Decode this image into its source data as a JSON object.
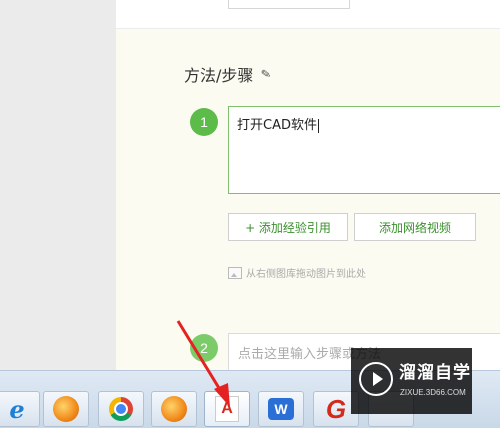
{
  "section": {
    "title": "方法/步骤",
    "edit_icon": "pencil-icon"
  },
  "step1": {
    "number": "1",
    "text": "打开CAD软件"
  },
  "buttons": {
    "add_ref": "+ 添加经验引用",
    "add_video": "添加网络视频"
  },
  "drag_hint": {
    "icon": "image-icon",
    "text": "从右侧图库拖动图片到此处"
  },
  "step2": {
    "number": "2",
    "placeholder": "点击这里输入步骤或方法"
  },
  "taskbar": {
    "items": [
      {
        "name": "ie-icon",
        "glyph": "e"
      },
      {
        "name": "fox-icon"
      },
      {
        "name": "chrome-icon"
      },
      {
        "name": "fox-icon"
      },
      {
        "name": "autocad-icon",
        "glyph": "A"
      },
      {
        "name": "wps-icon",
        "glyph": "W"
      },
      {
        "name": "g-app-icon",
        "glyph": "G"
      },
      {
        "name": "app-icon"
      }
    ]
  },
  "watermark": {
    "title": "溜溜自学",
    "subtitle": "ZIXUE.3D66.COM"
  },
  "colors": {
    "accent_green": "#5dbb4a",
    "annotation_arrow": "#e52222"
  }
}
